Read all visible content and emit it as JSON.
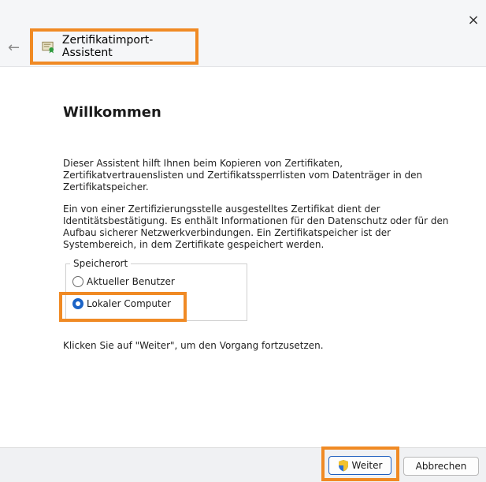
{
  "window": {
    "title": "Zertifikatimport-Assistent",
    "close_label": "×",
    "back_label": "←"
  },
  "content": {
    "heading": "Willkommen",
    "intro": "Dieser Assistent hilft Ihnen beim Kopieren von Zertifikaten, Zertifikatvertrauenslisten und Zertifikatssperrlisten vom Datenträger in den Zertifikatspeicher.",
    "description": "Ein von einer Zertifizierungsstelle ausgestelltes Zertifikat dient der Identitätsbestätigung. Es enthält Informationen für den Datenschutz oder für den Aufbau sicherer Netzwerkverbindungen. Ein Zertifikatspeicher ist der Systembereich, in dem Zertifikate gespeichert werden.",
    "store_location": {
      "legend": "Speicherort",
      "options": [
        {
          "label": "Aktueller Benutzer",
          "selected": false
        },
        {
          "label": "Lokaler Computer",
          "selected": true
        }
      ]
    },
    "continue_hint": "Klicken Sie auf \"Weiter\", um den Vorgang fortzusetzen."
  },
  "footer": {
    "next_label": "Weiter",
    "cancel_label": "Abbrechen"
  },
  "colors": {
    "highlight": "#f08a24",
    "accent": "#1c64c7"
  }
}
